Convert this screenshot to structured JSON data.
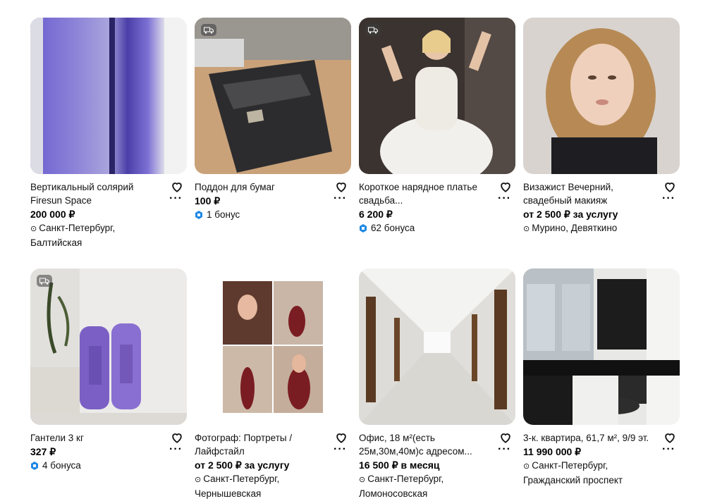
{
  "cards": [
    {
      "title": "Вертикальный солярий Firesun Space",
      "price": "200 000 ₽",
      "address": "Санкт-Петербург, Балтийская"
    },
    {
      "title": "Поддон для бумаг",
      "price": "100 ₽",
      "bonus": "1 бонус"
    },
    {
      "title": "Короткое нарядное платье свадьба...",
      "price": "6 200 ₽",
      "bonus": "62 бонуса"
    },
    {
      "title": "Визажист Вечерний, свадебный макияж",
      "price": "от 2 500 ₽ за услугу",
      "address": "Мурино, Девяткино"
    },
    {
      "title": "Гантели 3 кг",
      "price": "327 ₽",
      "bonus": "4 бонуса"
    },
    {
      "title": "Фотограф: Портреты / Лайфстайл",
      "price": "от 2 500 ₽ за услугу",
      "address": "Санкт-Петербург, Чернышевская"
    },
    {
      "title": "Офис, 18 м²(есть 25м,30м,40м)с адресом...",
      "price": "16 500 ₽ в месяц",
      "address": "Санкт-Петербург, Ломоносовская"
    },
    {
      "title": "3-к. квартира, 61,7 м², 9/9 эт.",
      "price": "11 990 000 ₽",
      "address": "Санкт-Петербург, Гражданский проспект"
    }
  ],
  "icons": {
    "favorite": "heart-icon",
    "more": "more-icon",
    "location": "location-pin-icon",
    "bonus": "bonus-icon",
    "delivery": "delivery-truck-icon"
  },
  "colors": {
    "bonus": "#1e88e5",
    "text": "#111111"
  }
}
